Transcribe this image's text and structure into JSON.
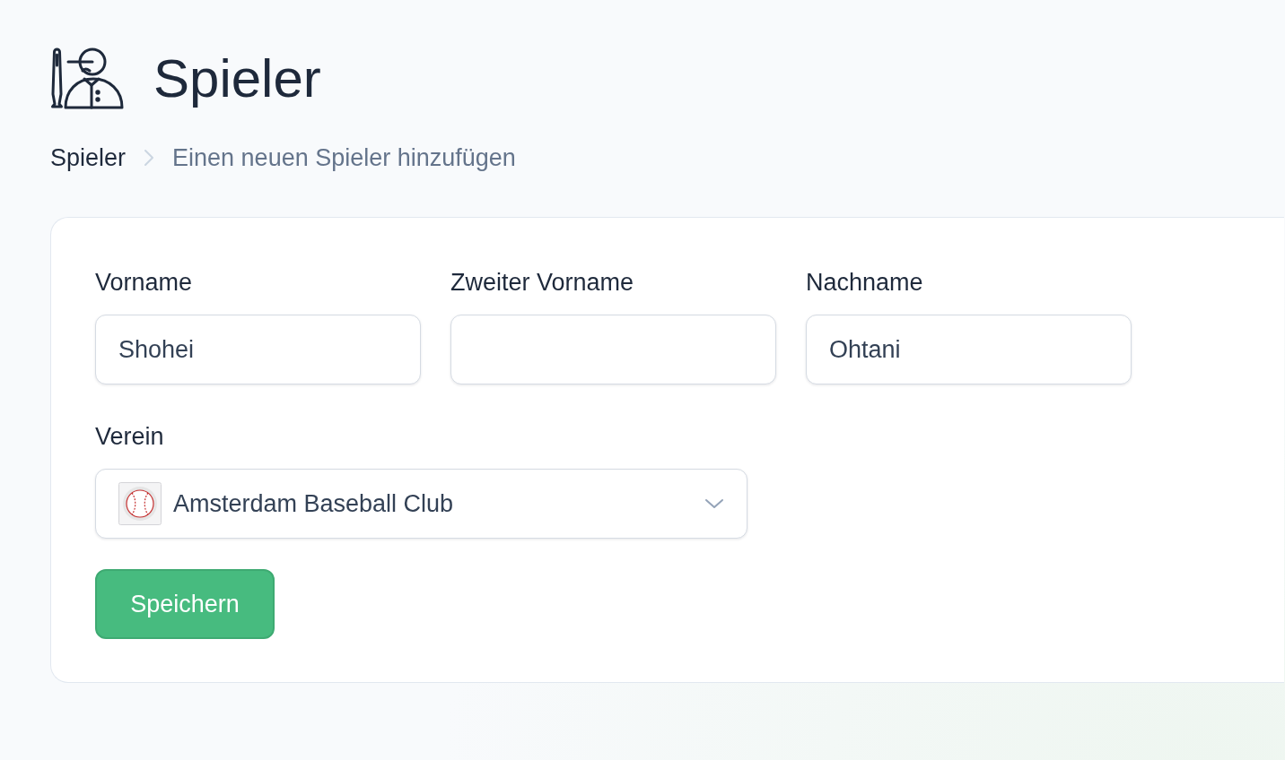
{
  "header": {
    "title": "Spieler"
  },
  "breadcrumb": [
    {
      "label": "Spieler",
      "current": false
    },
    {
      "label": "Einen neuen Spieler hinzufügen",
      "current": true
    }
  ],
  "form": {
    "fields": [
      {
        "label": "Vorname",
        "value": "Shohei"
      },
      {
        "label": "Zweiter Vorname"
      },
      {
        "label": "Nachname",
        "value": "Ohtani"
      }
    ],
    "club": {
      "label": "Verein",
      "value": "Amsterdam Baseball Club"
    },
    "submit": "Speichern"
  }
}
